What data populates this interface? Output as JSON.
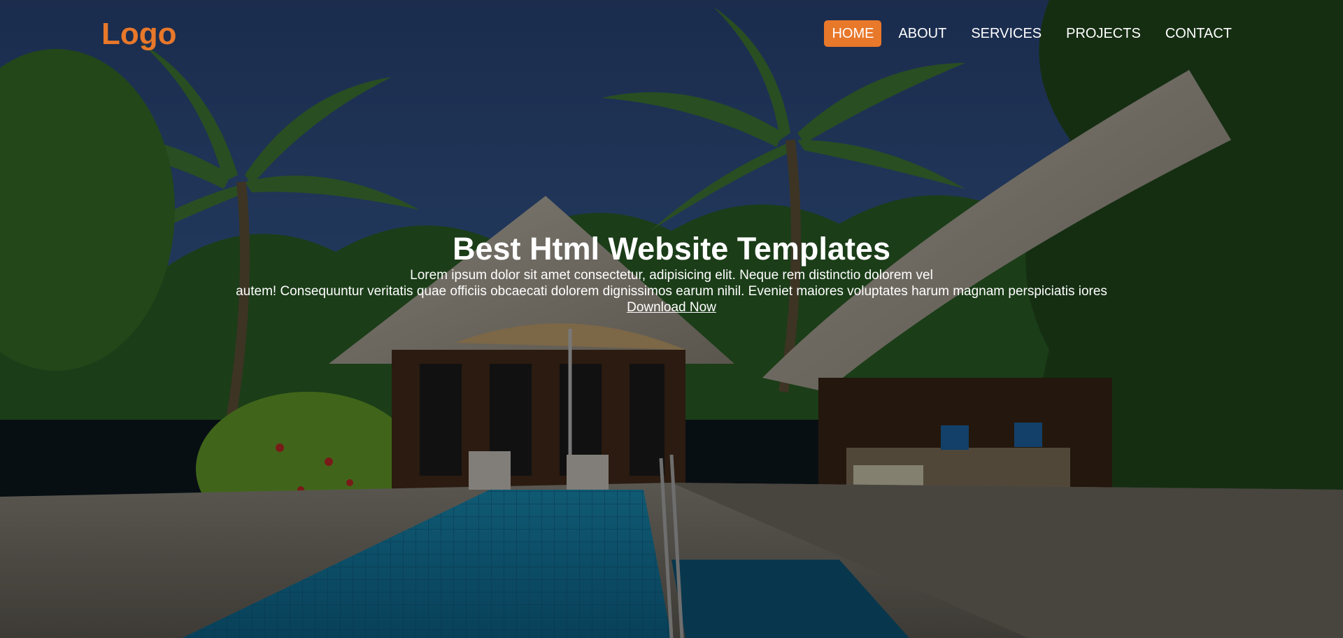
{
  "brand": {
    "logo_text": "Logo",
    "accent_color": "#e8782a"
  },
  "nav": {
    "items": [
      {
        "label": "HOME",
        "active": true
      },
      {
        "label": "ABOUT",
        "active": false
      },
      {
        "label": "SERVICES",
        "active": false
      },
      {
        "label": "PROJECTS",
        "active": false
      },
      {
        "label": "CONTACT",
        "active": false
      }
    ]
  },
  "hero": {
    "title": "Best Html Website Templates",
    "text_line1": "Lorem ipsum dolor sit amet consectetur, adipisicing elit. Neque rem distinctio dolorem vel",
    "text_line2": "autem! Consequuntur veritatis quae officiis obcaecati dolorem dignissimos earum nihil. Eveniet maiores voluptates harum magnam perspiciatis iores",
    "cta_label": "Download Now",
    "background": "tropical-resort-pool-photo"
  }
}
